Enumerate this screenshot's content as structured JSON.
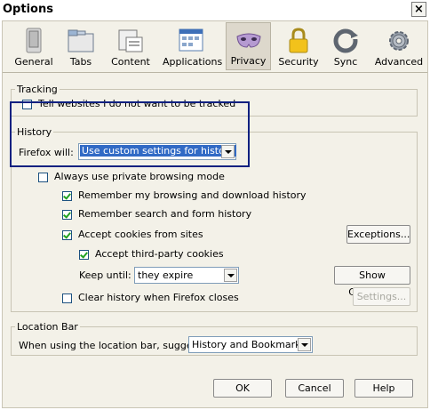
{
  "window": {
    "title": "Options",
    "close": "×"
  },
  "tabs": [
    {
      "label": "General",
      "icon": "general-icon"
    },
    {
      "label": "Tabs",
      "icon": "tabs-icon"
    },
    {
      "label": "Content",
      "icon": "content-icon"
    },
    {
      "label": "Applications",
      "icon": "applications-icon"
    },
    {
      "label": "Privacy",
      "icon": "privacy-icon",
      "selected": true
    },
    {
      "label": "Security",
      "icon": "security-icon"
    },
    {
      "label": "Sync",
      "icon": "sync-icon"
    },
    {
      "label": "Advanced",
      "icon": "advanced-icon"
    }
  ],
  "tracking": {
    "legend": "Tracking",
    "dnt_label": "Tell websites I do not want to be tracked",
    "dnt_checked": false
  },
  "history": {
    "legend": "History",
    "firefox_will_label": "Firefox will:",
    "firefox_will_value": "Use custom settings for history",
    "private_mode_label": "Always use private browsing mode",
    "private_mode_checked": false,
    "remember_browsing_label": "Remember my browsing and download history",
    "remember_browsing_checked": true,
    "remember_search_label": "Remember search and form history",
    "remember_search_checked": true,
    "accept_cookies_label": "Accept cookies from sites",
    "accept_cookies_checked": true,
    "exceptions_button": "Exceptions...",
    "third_party_label": "Accept third-party cookies",
    "third_party_checked": true,
    "keep_until_label": "Keep until:",
    "keep_until_value": "they expire",
    "show_cookies_button": "Show Cookies...",
    "clear_history_label": "Clear history when Firefox closes",
    "clear_history_checked": false,
    "settings_button": "Settings..."
  },
  "location_bar": {
    "legend": "Location Bar",
    "suggest_label": "When using the location bar, suggest:",
    "suggest_value": "History and Bookmarks"
  },
  "footer": {
    "ok": "OK",
    "cancel": "Cancel",
    "help": "Help"
  },
  "colors": {
    "dialog_bg": "#f3f1e8",
    "highlight": "#316ac5",
    "focus_border": "#0b2080"
  }
}
